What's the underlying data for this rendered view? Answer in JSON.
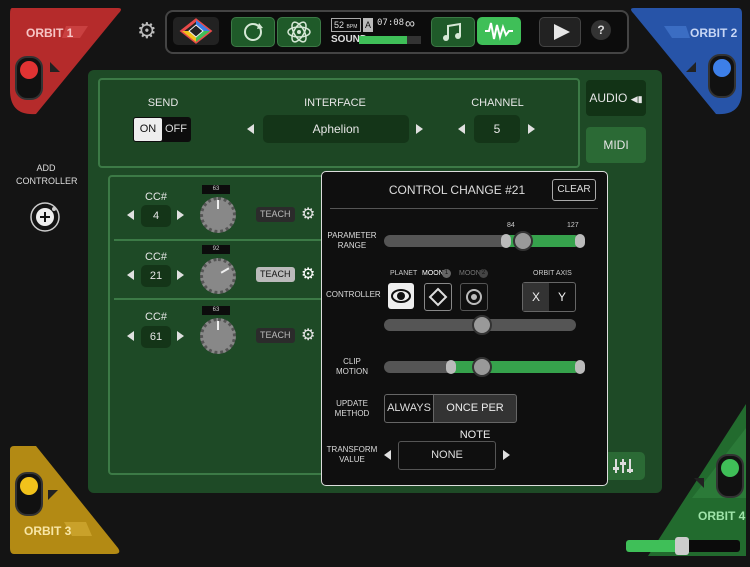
{
  "orbits": {
    "orbit1": {
      "label": "ORBIT 1",
      "color": "#b52b2b"
    },
    "orbit2": {
      "label": "ORBIT 2",
      "color": "#2754a8"
    },
    "orbit3": {
      "label": "ORBIT 3",
      "color": "#b38a14"
    },
    "orbit4": {
      "label": "ORBIT 4",
      "color": "#2b7a38",
      "slider_fraction": 0.49
    }
  },
  "topbar": {
    "bpm": "52",
    "bpm_unit": "BPM",
    "mode_letter": "A",
    "time": "07:08",
    "loop_symbol": "∞",
    "sound_label": "SOUND",
    "sound_level": 0.78,
    "help_label": "?"
  },
  "send": {
    "label": "SEND",
    "on": "ON",
    "off": "OFF"
  },
  "interface": {
    "label": "INTERFACE",
    "value": "Aphelion"
  },
  "channel": {
    "label": "CHANNEL",
    "value": "5"
  },
  "tabs": {
    "audio": "AUDIO",
    "midi": "MIDI"
  },
  "add_controller": {
    "line1": "ADD",
    "line2": "CONTROLLER"
  },
  "controllers": [
    {
      "cc_label": "CC#",
      "cc": "4",
      "knob_value": "63",
      "teach": "TEACH"
    },
    {
      "cc_label": "CC#",
      "cc": "21",
      "knob_value": "92",
      "teach": "TEACH"
    },
    {
      "cc_label": "CC#",
      "cc": "61",
      "knob_value": "63",
      "teach": "TEACH"
    }
  ],
  "popup": {
    "title": "CONTROL CHANGE #21",
    "clear": "CLEAR",
    "param_range_1": "PARAMETER",
    "param_range_2": "RANGE",
    "range_min": "84",
    "range_max": "127",
    "controller_label": "CONTROLLER",
    "planet": "PLANET",
    "moon1": "MOON",
    "moon1_badge": "1",
    "moon2": "MOON",
    "moon2_badge": "2",
    "orbit_axis": "ORBIT AXIS",
    "axis_x": "X",
    "axis_y": "Y",
    "clip_motion_1": "CLIP",
    "clip_motion_2": "MOTION",
    "update_method_1": "UPDATE",
    "update_method_2": "METHOD",
    "always": "ALWAYS",
    "once_per_note": "ONCE PER NOTE",
    "transform_1": "TRANSFORM",
    "transform_2": "VALUE",
    "transform_value": "NONE"
  }
}
